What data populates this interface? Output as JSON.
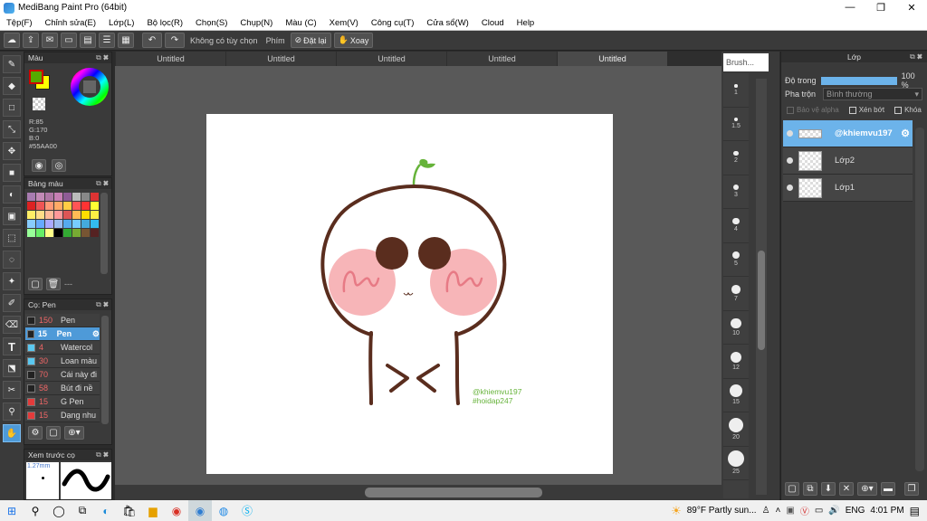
{
  "window": {
    "title": "MediBang Paint Pro (64bit)",
    "controls": [
      "—",
      "❐",
      "✕"
    ]
  },
  "menu": [
    "Tệp(F)",
    "Chỉnh sửa(E)",
    "Lớp(L)",
    "Bộ lọc(R)",
    "Chọn(S)",
    "Chụp(N)",
    "Màu (C)",
    "Xem(V)",
    "Công cụ(T)",
    "Cửa sổ(W)",
    "Cloud",
    "Help"
  ],
  "toolbar": {
    "selection_label": "Không có tùy chọn",
    "key_label": "Phím",
    "reset_label": "Đặt lại",
    "rotate_label": "Xoay"
  },
  "tabs": [
    "Untitled",
    "Untitled",
    "Untitled",
    "Untitled",
    "Untitled"
  ],
  "color_panel": {
    "title": "Màu",
    "r": "R:85",
    "g": "G:170",
    "b": "B:0",
    "hex": "#55AA00",
    "primary_color": "#55AA00",
    "secondary_color": "#FFFF00"
  },
  "palette_panel": {
    "title": "Bảng màu",
    "swatches": [
      "#a87cb0",
      "#c28ab6",
      "#b077a6",
      "#c77fb4",
      "#8f5c96",
      "#bbb",
      "#888",
      "#d33",
      "#d22",
      "#e55",
      "#f97",
      "#fa6",
      "#fc4",
      "#f55",
      "#f33",
      "#ff3",
      "#fe6",
      "#fd8",
      "#fb9",
      "#f99",
      "#d55",
      "#fb5",
      "#fd0",
      "#fe4",
      "#8cf",
      "#6af",
      "#aaf",
      "#9be",
      "#5ae",
      "#7cf",
      "#4ad",
      "#3be",
      "#9f9",
      "#6e6",
      "#ff8",
      "#000",
      "#3a3",
      "#7a3",
      "#753",
      "#522"
    ],
    "footer": "---"
  },
  "brush_panel": {
    "title": "Cọ: Pen",
    "items": [
      {
        "size": "150",
        "name": "Pen",
        "color": "#222"
      },
      {
        "size": "15",
        "name": "Pen",
        "color": "#222",
        "selected": true
      },
      {
        "size": "4",
        "name": "Watercol",
        "color": "#5ac8f0"
      },
      {
        "size": "30",
        "name": "Loan màu",
        "color": "#5ac8f0"
      },
      {
        "size": "70",
        "name": "Cái này đi",
        "color": "#222"
      },
      {
        "size": "58",
        "name": "Bút đi nề",
        "color": "#222"
      },
      {
        "size": "15",
        "name": "G Pen",
        "color": "#e23b3b"
      },
      {
        "size": "15",
        "name": "Dạng nhu",
        "color": "#e23b3b"
      }
    ]
  },
  "preview_panel": {
    "title": "Xem trước cọ",
    "size": "1.27mm"
  },
  "brush_size": {
    "title": "Brush...",
    "sizes": [
      "1",
      "1.5",
      "2",
      "3",
      "4",
      "5",
      "7",
      "10",
      "12",
      "15",
      "20",
      "25"
    ]
  },
  "layer_panel": {
    "title": "Lớp",
    "opacity_label": "Độ trong",
    "opacity_value": "100 %",
    "opacity": 1.0,
    "blend_label": "Pha trộn",
    "blend_value": "Bình thường",
    "protect_alpha": "Bảo vệ alpha",
    "clipping": "Xén bớt",
    "lock": "Khóa",
    "layers": [
      {
        "name": "@khiemvu197",
        "selected": true
      },
      {
        "name": "Lớp2",
        "selected": false
      },
      {
        "name": "Lớp1",
        "selected": false
      }
    ]
  },
  "canvas": {
    "watermark_line1": "@khiemvu197",
    "watermark_line2": "#hoidap247",
    "colors": {
      "stroke": "#5a2d1e",
      "blush": "#f7b5b8",
      "blush_line": "#e77a85",
      "eye": "#5a2d1e",
      "sprout": "#66b33a"
    }
  },
  "taskbar": {
    "weather": "89°F  Partly sun...",
    "language": "ENG",
    "time": "4:01 PM"
  }
}
